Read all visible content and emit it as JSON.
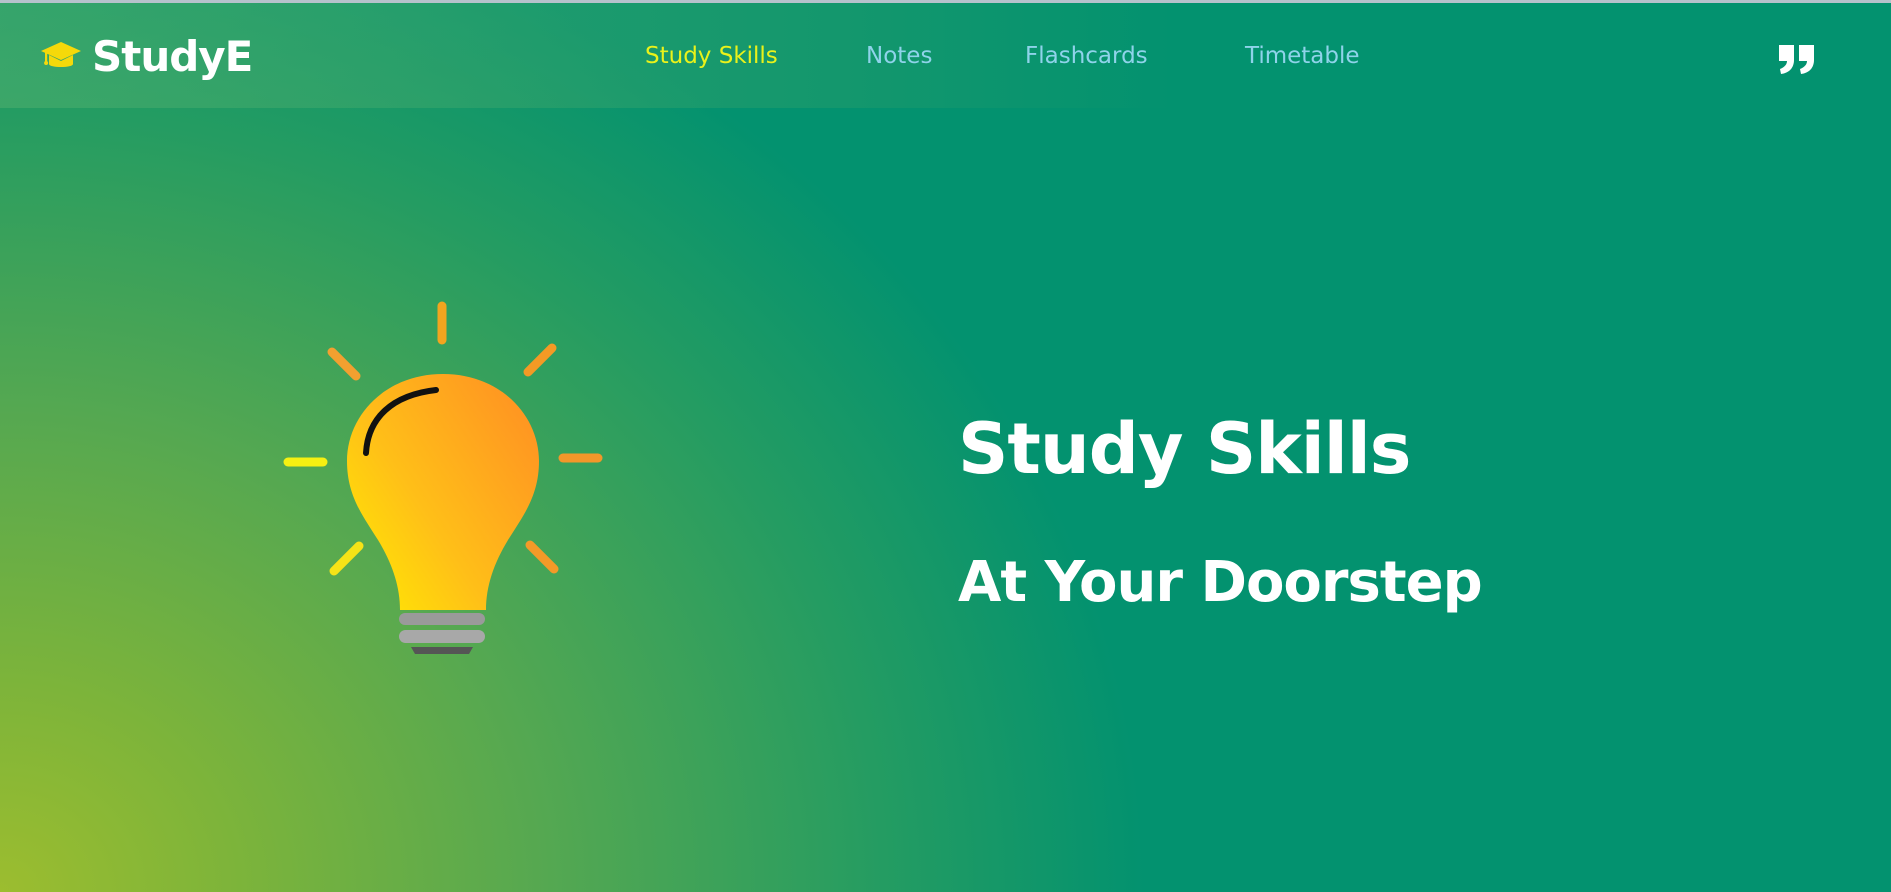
{
  "brand": {
    "name": "StudyE",
    "icon": "graduation-cap-icon",
    "icon_color": "#f5d90a"
  },
  "nav": {
    "items": [
      {
        "label": "Study Skills",
        "active": true
      },
      {
        "label": "Notes",
        "active": false
      },
      {
        "label": "Flashcards",
        "active": false
      },
      {
        "label": "Timetable",
        "active": false
      }
    ],
    "active_color": "#eaf21a",
    "inactive_color": "#8fd3ea"
  },
  "header_actions": {
    "quote_icon": "quote-icon"
  },
  "hero": {
    "title": "Study Skills",
    "subtitle": "At Your Doorstep",
    "illustration": "lightbulb-icon"
  },
  "colors": {
    "background": "#03926f",
    "gradient_corner": "#9cbd2f",
    "text": "#ffffff"
  }
}
